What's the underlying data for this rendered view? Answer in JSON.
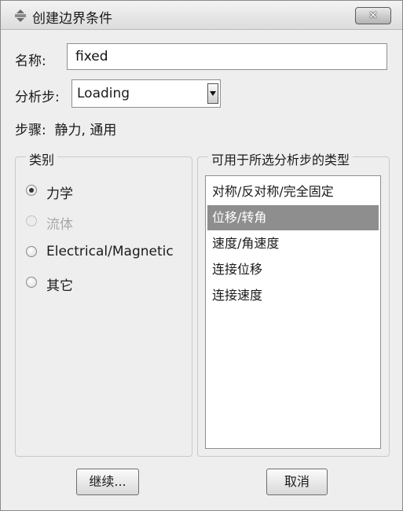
{
  "window": {
    "title": "创建边界条件",
    "close_label": "✕"
  },
  "form": {
    "name_label": "名称:",
    "name_value": "fixed",
    "step_label": "分析步:",
    "step_value": "Loading",
    "procedure_text": "步骤:  静力, 通用"
  },
  "category": {
    "title": "类别",
    "options": [
      {
        "label": "力学",
        "state": "checked"
      },
      {
        "label": "流体",
        "state": "disabled"
      },
      {
        "label": "Electrical/Magnetic",
        "state": "unchecked"
      },
      {
        "label": "其它",
        "state": "unchecked"
      }
    ]
  },
  "types": {
    "title": "可用于所选分析步的类型",
    "items": [
      "对称/反对称/完全固定",
      "位移/转角",
      "速度/角速度",
      "连接位移",
      "连接速度"
    ],
    "selected_index": 1
  },
  "buttons": {
    "continue_label": "继续...",
    "cancel_label": "取消"
  },
  "colors": {
    "selection": "#8e8e8e",
    "dialog_background": "#eeeeee"
  }
}
